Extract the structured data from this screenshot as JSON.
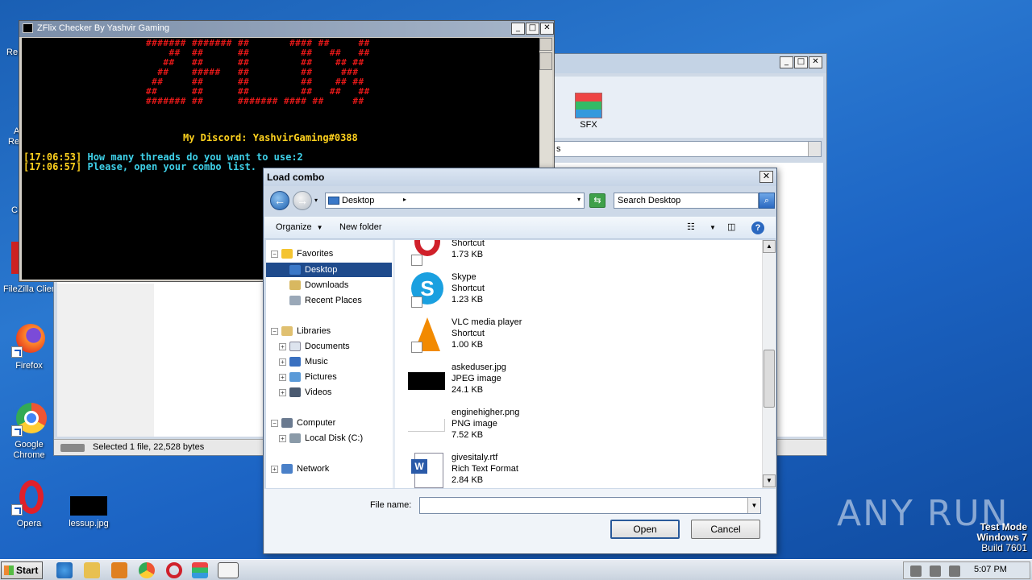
{
  "desktop": {
    "partial_labels": [
      "Re",
      "A",
      "Re",
      "C"
    ],
    "filezilla_label": "FileZilla Client",
    "icons": [
      {
        "label": "Firefox"
      },
      {
        "label": "Google Chrome"
      },
      {
        "label": "Opera"
      },
      {
        "label": "lessup.jpg"
      }
    ]
  },
  "bg_window": {
    "sfx_label": "SFX",
    "addr_text": "s",
    "status_text": "Selected 1 file, 22,528 bytes"
  },
  "console": {
    "title": "ZFlix Checker By Yashvir Gaming",
    "banner": "####### ####### ##       #### ##     ##\n    ##  ##      ##         ##   ##   ##\n   ##   ##      ##         ##    ## ##\n  ##    #####   ##         ##     ###\n ##     ##      ##         ##    ## ##\n##      ##      ##         ##   ##   ##\n####### ##      ####### #### ##     ##",
    "discord_label": "My Discord: ",
    "discord_value": "YashvirGaming#0388",
    "lines": [
      {
        "ts": "[17:06:53]",
        "msg": " How many threads do you want to use:2"
      },
      {
        "ts": "[17:06:57]",
        "msg": " Please, open your combo list."
      }
    ]
  },
  "dialog": {
    "title": "Load combo",
    "location": "Desktop",
    "search_placeholder": "Search Desktop",
    "organize_label": "Organize",
    "new_folder_label": "New folder",
    "nav": {
      "favorites": "Favorites",
      "desktop": "Desktop",
      "downloads": "Downloads",
      "recent": "Recent Places",
      "libraries": "Libraries",
      "documents": "Documents",
      "music": "Music",
      "pictures": "Pictures",
      "videos": "Videos",
      "computer": "Computer",
      "local_disk": "Local Disk (C:)",
      "network": "Network"
    },
    "files": [
      {
        "name": "",
        "type": "Shortcut",
        "size": "1.73 KB"
      },
      {
        "name": "Skype",
        "type": "Shortcut",
        "size": "1.23 KB"
      },
      {
        "name": "VLC media player",
        "type": "Shortcut",
        "size": "1.00 KB"
      },
      {
        "name": "askeduser.jpg",
        "type": "JPEG image",
        "size": "24.1 KB"
      },
      {
        "name": "enginehigher.png",
        "type": "PNG image",
        "size": "7.52 KB"
      },
      {
        "name": "givesitaly.rtf",
        "type": "Rich Text Format",
        "size": "2.84 KB"
      }
    ],
    "filename_label": "File name:",
    "filename_value": "",
    "open_label": "Open",
    "cancel_label": "Cancel"
  },
  "taskbar": {
    "start_label": "Start",
    "clock": "5:07 PM"
  },
  "watermark": "ANY RUN",
  "testmode": {
    "line1": "Test Mode",
    "line2": "Windows 7",
    "line3": "Build 7601"
  }
}
